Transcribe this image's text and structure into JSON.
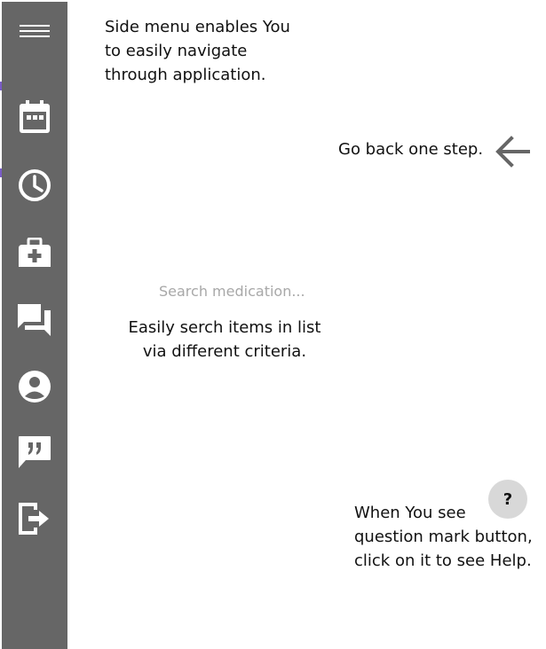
{
  "sidebar": {
    "background": "#666666",
    "icon_color": "#ffffff",
    "items": [
      {
        "icon": "hamburger-menu-icon"
      },
      {
        "icon": "calendar-icon"
      },
      {
        "icon": "clock-icon"
      },
      {
        "icon": "medical-bag-icon"
      },
      {
        "icon": "chat-icon"
      },
      {
        "icon": "account-circle-icon"
      },
      {
        "icon": "quote-bubble-icon"
      },
      {
        "icon": "logout-icon"
      }
    ]
  },
  "notes": {
    "menu": "Side menu enables You\nto easily navigate\nthrough application.",
    "back": "Go back one step.",
    "search": "Easily serch items in list\nvia different criteria.",
    "help": "When You see\nquestion mark button,\nclick on it to see Help."
  },
  "back_button": {
    "icon": "arrow-left-icon",
    "color": "#666666"
  },
  "search": {
    "placeholder": "Search medication...",
    "value": ""
  },
  "help_button": {
    "label": "?",
    "background": "#d8d8d8"
  }
}
